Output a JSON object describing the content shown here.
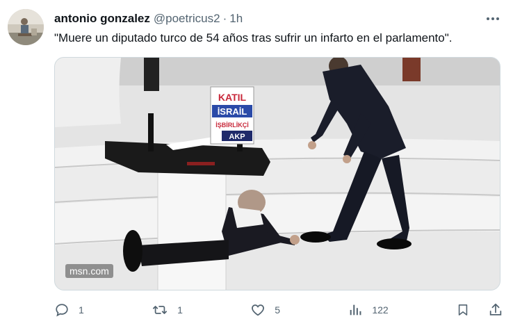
{
  "tweet": {
    "author_name": "antonio gonzalez",
    "author_handle": "@poetricus2",
    "separator": "·",
    "time": "1h",
    "text": "\"Muere un diputado turco de 54 años tras sufrir un infarto en el parlamento\".",
    "media": {
      "watermark": "msn.com",
      "sign_lines": [
        "KATIL",
        "İSRAİL",
        "İŞBİRLİKÇİ",
        "AKP"
      ],
      "podium_label": "",
      "colors": {
        "sign_red": "#c8283a",
        "sign_blue": "#2a4aa8",
        "suit": "#1a1d2a"
      }
    },
    "actions": {
      "reply_icon": "reply-icon",
      "reply_count": "1",
      "retweet_icon": "retweet-icon",
      "retweet_count": "1",
      "like_icon": "heart-icon",
      "like_count": "5",
      "views_icon": "views-chart-icon",
      "views_count": "122",
      "bookmark_icon": "bookmark-icon",
      "share_icon": "share-icon"
    }
  },
  "colors": {
    "text": "#0f1419",
    "secondary": "#536471",
    "border": "#cfd9de"
  }
}
